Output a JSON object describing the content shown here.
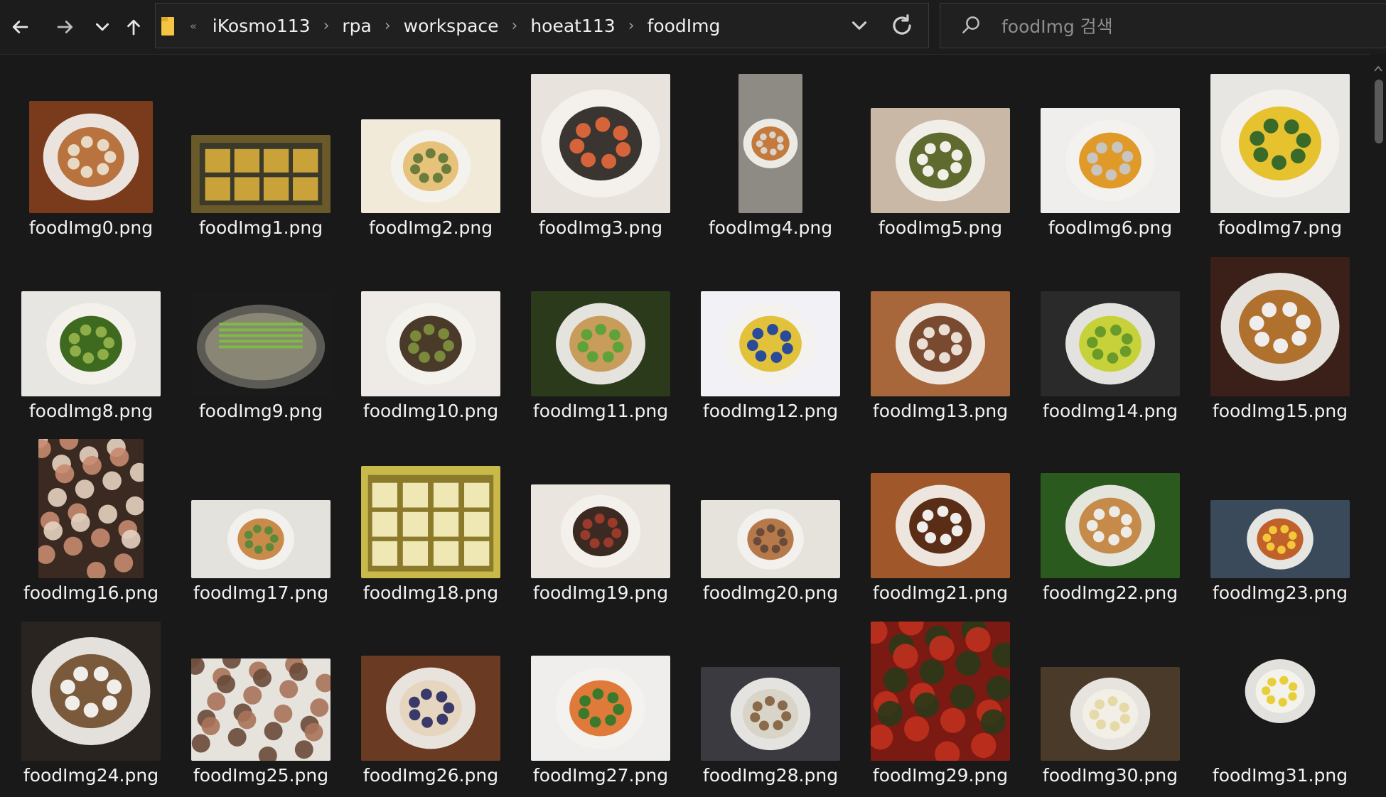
{
  "nav": {
    "back_icon": "arrow-left-icon",
    "forward_icon": "arrow-right-icon",
    "recent_icon": "chevron-down-icon",
    "up_icon": "arrow-up-icon"
  },
  "address": {
    "lead": "«",
    "crumbs": [
      "iKosmo113",
      "rpa",
      "workspace",
      "hoeat113",
      "foodImg"
    ]
  },
  "search": {
    "placeholder": "foodImg 검색",
    "value": ""
  },
  "files": [
    {
      "name": "foodImg0.png",
      "palette": [
        "#7a3b1c",
        "#b9733e",
        "#e8d9c4"
      ],
      "w": 174,
      "h": 158,
      "plate": "bowl"
    },
    {
      "name": "foodImg1.png",
      "palette": [
        "#6a5a2a",
        "#c9a33a",
        "#3d3418"
      ],
      "w": 196,
      "h": 110,
      "plate": "tray"
    },
    {
      "name": "foodImg2.png",
      "palette": [
        "#f1ead9",
        "#e7c27b",
        "#6a7d3c"
      ],
      "w": 196,
      "h": 132,
      "plate": "plate"
    },
    {
      "name": "foodImg3.png",
      "palette": [
        "#e9e3de",
        "#3a3530",
        "#d6643a"
      ],
      "w": 196,
      "h": 196,
      "plate": "plate"
    },
    {
      "name": "foodImg4.png",
      "palette": [
        "#8e8a84",
        "#c47a3c",
        "#d9d4cb"
      ],
      "w": 90,
      "h": 196,
      "plate": "bowl"
    },
    {
      "name": "foodImg5.png",
      "palette": [
        "#c9b8a6",
        "#5f6a2e",
        "#f2efe8"
      ],
      "w": 196,
      "h": 148,
      "plate": "plate"
    },
    {
      "name": "foodImg6.png",
      "palette": [
        "#f0eeec",
        "#e09a2a",
        "#c8c4c0"
      ],
      "w": 196,
      "h": 148,
      "plate": "bowl"
    },
    {
      "name": "foodImg7.png",
      "palette": [
        "#e8e6e3",
        "#e6c22e",
        "#3a6a2a"
      ],
      "w": 196,
      "h": 196,
      "plate": "plate"
    },
    {
      "name": "foodImg8.png",
      "palette": [
        "#e8e6e2",
        "#3d6a1e",
        "#8fae4a"
      ],
      "w": 196,
      "h": 148,
      "plate": "plate"
    },
    {
      "name": "foodImg9.png",
      "palette": [
        "#1a1a1a",
        "#8a8676",
        "#7dbb45"
      ],
      "w": 196,
      "h": 148,
      "plate": "pot"
    },
    {
      "name": "foodImg10.png",
      "palette": [
        "#eeebe6",
        "#4a3a2a",
        "#7a8a3a"
      ],
      "w": 196,
      "h": 148,
      "plate": "bowl"
    },
    {
      "name": "foodImg11.png",
      "palette": [
        "#2a3a1a",
        "#c89c5a",
        "#5da33a"
      ],
      "w": 196,
      "h": 148,
      "plate": "plate"
    },
    {
      "name": "foodImg12.png",
      "palette": [
        "#f2f2f6",
        "#e2c23a",
        "#2a4a9a"
      ],
      "w": 196,
      "h": 148,
      "plate": "plate"
    },
    {
      "name": "foodImg13.png",
      "palette": [
        "#a8673a",
        "#7a4a30",
        "#e9dfd4"
      ],
      "w": 196,
      "h": 148,
      "plate": "plate"
    },
    {
      "name": "foodImg14.png",
      "palette": [
        "#2a2a2a",
        "#c7d23a",
        "#6a9a2a"
      ],
      "w": 196,
      "h": 148,
      "plate": "plate"
    },
    {
      "name": "foodImg15.png",
      "palette": [
        "#3a2018",
        "#b0702e",
        "#f0eeec"
      ],
      "w": 196,
      "h": 196,
      "plate": "bowl"
    },
    {
      "name": "foodImg16.png",
      "palette": [
        "#3a2a22",
        "#c68a6e",
        "#e6d2c0"
      ],
      "w": 148,
      "h": 196,
      "plate": "pile"
    },
    {
      "name": "foodImg17.png",
      "palette": [
        "#e4e2dc",
        "#c98a4a",
        "#5a8a3a"
      ],
      "w": 196,
      "h": 110,
      "plate": "plate"
    },
    {
      "name": "foodImg18.png",
      "palette": [
        "#c9b84a",
        "#efe7b4",
        "#8a7a2a"
      ],
      "w": 196,
      "h": 158,
      "plate": "jar"
    },
    {
      "name": "foodImg19.png",
      "palette": [
        "#eae6df",
        "#3a2a22",
        "#9a3a2a"
      ],
      "w": 196,
      "h": 132,
      "plate": "plate"
    },
    {
      "name": "foodImg20.png",
      "palette": [
        "#e6e2dc",
        "#b67a4a",
        "#6a4a3a"
      ],
      "w": 196,
      "h": 110,
      "plate": "plate"
    },
    {
      "name": "foodImg21.png",
      "palette": [
        "#a0582a",
        "#5a2e16",
        "#f0eeec"
      ],
      "w": 196,
      "h": 148,
      "plate": "bowl"
    },
    {
      "name": "foodImg22.png",
      "palette": [
        "#2a5a1e",
        "#c68a4a",
        "#ecebe6"
      ],
      "w": 196,
      "h": 148,
      "plate": "plate"
    },
    {
      "name": "foodImg23.png",
      "palette": [
        "#3a4a5a",
        "#c0602a",
        "#f2c83a"
      ],
      "w": 196,
      "h": 110,
      "plate": "plate"
    },
    {
      "name": "foodImg24.png",
      "palette": [
        "#2a2420",
        "#7a5a3a",
        "#f0eeea"
      ],
      "w": 196,
      "h": 196,
      "plate": "bowl"
    },
    {
      "name": "foodImg25.png",
      "palette": [
        "#e6e2dc",
        "#6a4a3a",
        "#a8735a"
      ],
      "w": 196,
      "h": 144,
      "plate": "pile"
    },
    {
      "name": "foodImg26.png",
      "palette": [
        "#6a3a22",
        "#e6d6c0",
        "#3a3a6a"
      ],
      "w": 196,
      "h": 148,
      "plate": "plate"
    },
    {
      "name": "foodImg27.png",
      "palette": [
        "#f0eeec",
        "#e07a3a",
        "#3a7a2a"
      ],
      "w": 196,
      "h": 148,
      "plate": "plate"
    },
    {
      "name": "foodImg28.png",
      "palette": [
        "#3a3a40",
        "#d9d4c8",
        "#8a6a4a"
      ],
      "w": 196,
      "h": 132,
      "plate": "plate"
    },
    {
      "name": "foodImg29.png",
      "palette": [
        "#7a1a12",
        "#c0301e",
        "#2a3a1a"
      ],
      "w": 196,
      "h": 196,
      "plate": "pile"
    },
    {
      "name": "foodImg30.png",
      "palette": [
        "#4a3a2a",
        "#f2efe6",
        "#e6d9a8"
      ],
      "w": 196,
      "h": 132,
      "plate": "bowl"
    },
    {
      "name": "foodImg31.png",
      "palette": [
        "#1a1a1a",
        "#f4f2ec",
        "#e8cf3a"
      ],
      "w": 116,
      "h": 196,
      "plate": "plate"
    }
  ]
}
